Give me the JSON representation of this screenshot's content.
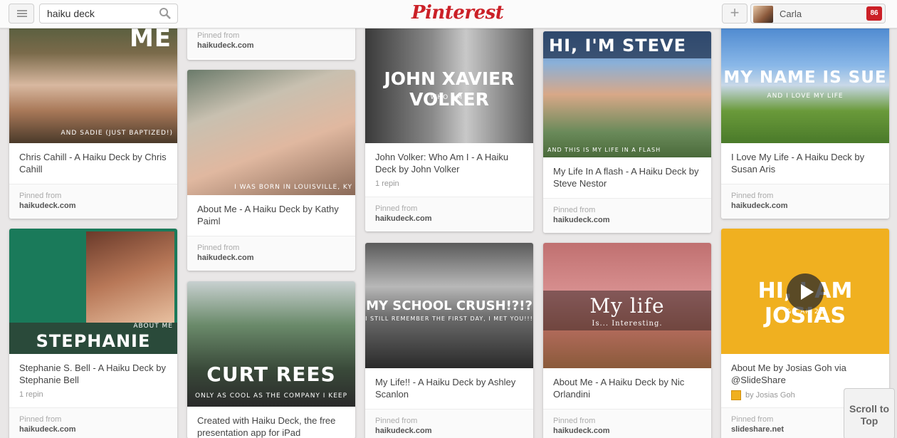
{
  "header": {
    "search_value": "haiku deck",
    "logo": "Pinterest",
    "add_label": "+",
    "user_name": "Carla",
    "notifications": "86"
  },
  "pins": [
    {
      "id": "chris",
      "caption": "ME",
      "subcaption": "AND SADIE (JUST BAPTIZED!)",
      "desc": "Chris Cahill - A Haiku Deck by Chris Cahill",
      "repin": "",
      "pinned_from": "Pinned from",
      "source": "haikudeck.com"
    },
    {
      "id": "top2",
      "caption": "",
      "subcaption": "",
      "desc": "",
      "repin": "",
      "pinned_from": "Pinned from",
      "source": "haikudeck.com"
    },
    {
      "id": "kathy",
      "caption": "",
      "subcaption": "I WAS BORN IN LOUISVILLE, KY",
      "desc": "About Me - A Haiku Deck by Kathy Paiml",
      "repin": "",
      "pinned_from": "Pinned from",
      "source": "haikudeck.com"
    },
    {
      "id": "john",
      "caption": "JOHN XAVIER VOLKER",
      "subcaption": "WHO AM I",
      "desc": "John Volker: Who Am I - A Haiku Deck by John Volker",
      "repin": "1 repin",
      "pinned_from": "Pinned from",
      "source": "haikudeck.com"
    },
    {
      "id": "steve",
      "caption": "HI, I'M STEVE",
      "subcaption": "AND THIS IS MY LIFE IN A FLASH",
      "desc": "My Life In A flash - A Haiku Deck by Steve Nestor",
      "repin": "",
      "pinned_from": "Pinned from",
      "source": "haikudeck.com"
    },
    {
      "id": "sue",
      "caption": "MY NAME IS SUE",
      "subcaption": "AND I LOVE MY LIFE",
      "desc": "I Love My Life - A Haiku Deck by Susan Aris",
      "repin": "",
      "pinned_from": "Pinned from",
      "source": "haikudeck.com"
    },
    {
      "id": "stephanie",
      "caption": "STEPHANIE BELL",
      "subcaption": "ABOUT ME",
      "desc": "Stephanie S. Bell - A Haiku Deck by Stephanie Bell",
      "repin": "1 repin",
      "pinned_from": "Pinned from",
      "source": "haikudeck.com"
    },
    {
      "id": "curt",
      "caption": "CURT REES",
      "subcaption": "ONLY AS COOL AS THE COMPANY I KEEP",
      "desc": "Created with Haiku Deck, the free presentation app for iPad",
      "repin": "",
      "pinned_from": "Pinned from",
      "source": "haikudeck.com"
    },
    {
      "id": "ashley",
      "caption": "MY SCHOOL CRUSH!?!?",
      "subcaption": "I STILL REMEMBER THE FIRST DAY, I MET YOU!!!",
      "desc": "My Life!! - A Haiku Deck by Ashley Scanlon",
      "repin": "",
      "pinned_from": "Pinned from",
      "source": "haikudeck.com"
    },
    {
      "id": "nic",
      "caption": "My life",
      "subcaption": "Is... Interesting.",
      "desc": "About Me - A Haiku Deck by Nic Orlandini",
      "repin": "",
      "pinned_from": "Pinned from",
      "source": "haikudeck.com"
    },
    {
      "id": "josias",
      "caption": "HI, I AM JOSIAS",
      "subcaption": "& I AM 21",
      "desc": "About Me by Josias Goh via @SlideShare",
      "byline": "by Josias Goh",
      "repin": "",
      "pinned_from": "Pinned from",
      "source": "slideshare.net"
    }
  ],
  "scroll_top": "Scroll to Top",
  "colors": {
    "brand": "#cb2027",
    "background": "#e9e7e7"
  }
}
